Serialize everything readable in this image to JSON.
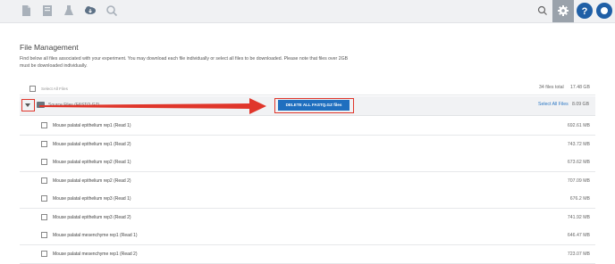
{
  "toolbar": {
    "icons": [
      "document-icon",
      "notebook-icon",
      "flask-icon",
      "cloud-download-icon",
      "search-icon"
    ],
    "right_icons": [
      "search-icon",
      "gear-icon",
      "help-icon",
      "user-icon"
    ],
    "accent": "#1f6fbf"
  },
  "page": {
    "title": "File Management",
    "description": "Find below all files associated with your experiment. You may download each file individually or select all files to be downloaded. Please note that files over 2GB must be downloaded individually."
  },
  "summary": {
    "select_all_label": "Select All Files",
    "files_total": "34 files total",
    "total_size": "17.48 GB"
  },
  "group": {
    "name": "Source Files (FASTQ.GZ)",
    "button_label": "DELETE ALL FASTQ.GZ files",
    "select_link": "Select All Files",
    "size": "8.09 GB"
  },
  "files": [
    {
      "name": "Mouse palatal epithelium rep1 (Read 1)",
      "size": "692.61 MB"
    },
    {
      "name": "Mouse palatal epithelium rep1 (Read 2)",
      "size": "743.72 MB"
    },
    {
      "name": "Mouse palatal epithelium rep2 (Read 1)",
      "size": "673.62 MB"
    },
    {
      "name": "Mouse palatal epithelium rep2 (Read 2)",
      "size": "707.09 MB"
    },
    {
      "name": "Mouse palatal epithelium rep3 (Read 1)",
      "size": "676.2 MB"
    },
    {
      "name": "Mouse palatal epithelium rep3 (Read 2)",
      "size": "741.92 MB"
    },
    {
      "name": "Mouse palatal mesenchyme rep1 (Read 1)",
      "size": "646.47 MB"
    },
    {
      "name": "Mouse palatal mesenchyme rep1 (Read 2)",
      "size": "723.07 MB"
    }
  ]
}
